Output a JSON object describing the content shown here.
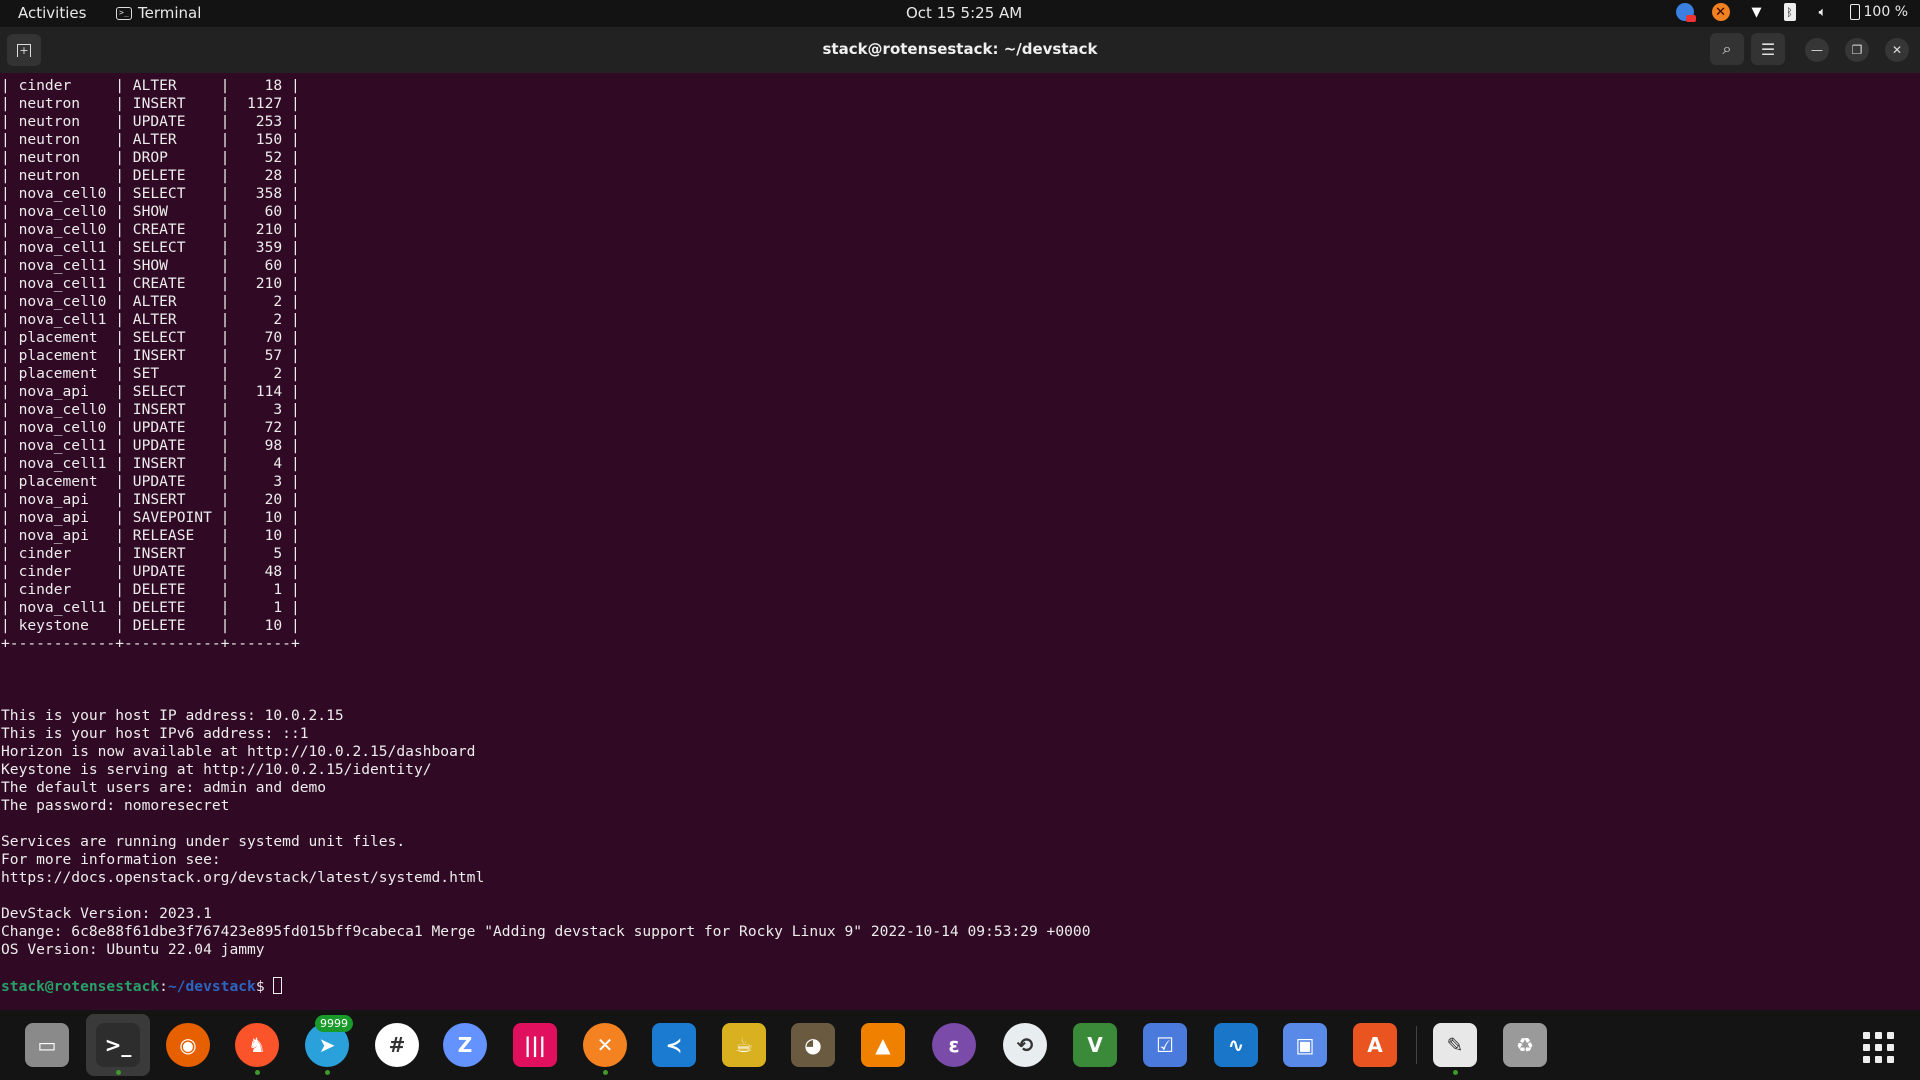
{
  "topbar": {
    "activities": "Activities",
    "app_name": "Terminal",
    "clock": "Oct 15  5:25 AM",
    "battery": "100 %",
    "tray_icons": [
      "chrome-remote-icon",
      "xampp-icon",
      "wifi-icon",
      "bluetooth-icon",
      "volume-icon",
      "battery-icon"
    ]
  },
  "window": {
    "title": "stack@rotensestack: ~/devstack",
    "buttons": [
      "new-tab",
      "search",
      "menu",
      "minimize",
      "maximize",
      "close"
    ]
  },
  "terminal": {
    "table_rows": [
      [
        "cinder",
        "ALTER",
        "18"
      ],
      [
        "neutron",
        "INSERT",
        "1127"
      ],
      [
        "neutron",
        "UPDATE",
        "253"
      ],
      [
        "neutron",
        "ALTER",
        "150"
      ],
      [
        "neutron",
        "DROP",
        "52"
      ],
      [
        "neutron",
        "DELETE",
        "28"
      ],
      [
        "nova_cell0",
        "SELECT",
        "358"
      ],
      [
        "nova_cell0",
        "SHOW",
        "60"
      ],
      [
        "nova_cell0",
        "CREATE",
        "210"
      ],
      [
        "nova_cell1",
        "SELECT",
        "359"
      ],
      [
        "nova_cell1",
        "SHOW",
        "60"
      ],
      [
        "nova_cell1",
        "CREATE",
        "210"
      ],
      [
        "nova_cell0",
        "ALTER",
        "2"
      ],
      [
        "nova_cell1",
        "ALTER",
        "2"
      ],
      [
        "placement",
        "SELECT",
        "70"
      ],
      [
        "placement",
        "INSERT",
        "57"
      ],
      [
        "placement",
        "SET",
        "2"
      ],
      [
        "nova_api",
        "SELECT",
        "114"
      ],
      [
        "nova_cell0",
        "INSERT",
        "3"
      ],
      [
        "nova_cell0",
        "UPDATE",
        "72"
      ],
      [
        "nova_cell1",
        "UPDATE",
        "98"
      ],
      [
        "nova_cell1",
        "INSERT",
        "4"
      ],
      [
        "placement",
        "UPDATE",
        "3"
      ],
      [
        "nova_api",
        "INSERT",
        "20"
      ],
      [
        "nova_api",
        "SAVEPOINT",
        "10"
      ],
      [
        "nova_api",
        "RELEASE",
        "10"
      ],
      [
        "cinder",
        "INSERT",
        "5"
      ],
      [
        "cinder",
        "UPDATE",
        "48"
      ],
      [
        "cinder",
        "DELETE",
        "1"
      ],
      [
        "nova_cell1",
        "DELETE",
        "1"
      ],
      [
        "keystone",
        "DELETE",
        "10"
      ]
    ],
    "table_border": "+------------+-----------+-------+",
    "output_lines": [
      "",
      "",
      "",
      "This is your host IP address: 10.0.2.15",
      "This is your host IPv6 address: ::1",
      "Horizon is now available at http://10.0.2.15/dashboard",
      "Keystone is serving at http://10.0.2.15/identity/",
      "The default users are: admin and demo",
      "The password: nomoresecret",
      "",
      "Services are running under systemd unit files.",
      "For more information see:",
      "https://docs.openstack.org/devstack/latest/systemd.html",
      "",
      "DevStack Version: 2023.1",
      "Change: 6c8e88f61dbe3f767423e895fd015bff9cabeca1 Merge \"Adding devstack support for Rocky Linux 9\" 2022-10-14 09:53:29 +0000",
      "OS Version: Ubuntu 22.04 jammy",
      ""
    ],
    "prompt_user": "stack@rotensestack",
    "prompt_sep": ":",
    "prompt_path": "~/devstack",
    "prompt_symbol": "$ "
  },
  "dock": {
    "items": [
      {
        "name": "files",
        "label": "Files",
        "color": "#8a8a8a",
        "glyph": "▭",
        "running": false,
        "active": false
      },
      {
        "name": "terminal",
        "label": "Terminal",
        "color": "#2d2d2d",
        "glyph": ">_",
        "running": true,
        "active": true
      },
      {
        "name": "firefox",
        "label": "Firefox",
        "color": "#e66000",
        "glyph": "◉",
        "running": false,
        "active": false
      },
      {
        "name": "brave",
        "label": "Brave",
        "color": "#fb542b",
        "glyph": "♞",
        "running": true,
        "active": false
      },
      {
        "name": "telegram",
        "label": "Telegram",
        "color": "#2aa1da",
        "glyph": "➤",
        "running": true,
        "active": false,
        "badge": "9999"
      },
      {
        "name": "slack",
        "label": "Slack",
        "color": "#ffffff",
        "glyph": "#",
        "running": false,
        "active": false
      },
      {
        "name": "zulip",
        "label": "Zulip",
        "color": "#6492fe",
        "glyph": "Z",
        "running": false,
        "active": false
      },
      {
        "name": "gitkraken",
        "label": "GitKraken",
        "color": "#e0105f",
        "glyph": "|||",
        "running": false,
        "active": false
      },
      {
        "name": "xampp",
        "label": "XAMPP",
        "color": "#f58220",
        "glyph": "✕",
        "running": true,
        "active": false
      },
      {
        "name": "vscode",
        "label": "Visual Studio Code",
        "color": "#1a7bd0",
        "glyph": "≺",
        "running": false,
        "active": false
      },
      {
        "name": "teapot",
        "label": "Teapot",
        "color": "#d8b020",
        "glyph": "☕",
        "running": false,
        "active": false
      },
      {
        "name": "gimp",
        "label": "GIMP",
        "color": "#6a5a40",
        "glyph": "◕",
        "running": false,
        "active": false
      },
      {
        "name": "vlc",
        "label": "VLC",
        "color": "#f08000",
        "glyph": "▲",
        "running": false,
        "active": false
      },
      {
        "name": "emacs",
        "label": "Emacs",
        "color": "#7a4ba8",
        "glyph": "ε",
        "running": false,
        "active": false
      },
      {
        "name": "remmina",
        "label": "Remmina",
        "color": "#e8eef0",
        "glyph": "⟲",
        "running": false,
        "active": false
      },
      {
        "name": "vim",
        "label": "Vim",
        "color": "#3a8a3a",
        "glyph": "V",
        "running": false,
        "active": false
      },
      {
        "name": "tasks",
        "label": "Tasks",
        "color": "#4a7adc",
        "glyph": "☑",
        "running": false,
        "active": false
      },
      {
        "name": "system-monitor",
        "label": "System Monitor",
        "color": "#1a76c8",
        "glyph": "∿",
        "running": false,
        "active": false
      },
      {
        "name": "workspaces",
        "label": "Workspaces",
        "color": "#5a8ae8",
        "glyph": "▣",
        "running": false,
        "active": false
      },
      {
        "name": "app-center",
        "label": "Ubuntu Software",
        "color": "#e95420",
        "glyph": "A",
        "running": false,
        "active": false
      },
      {
        "name": "text-editor",
        "label": "Text Editor",
        "color": "#e8e8e8",
        "glyph": "✎",
        "running": true,
        "active": false
      },
      {
        "name": "trash",
        "label": "Trash",
        "color": "#9a9a9a",
        "glyph": "♻",
        "running": false,
        "active": false
      }
    ],
    "show_apps_label": "Show Applications"
  }
}
